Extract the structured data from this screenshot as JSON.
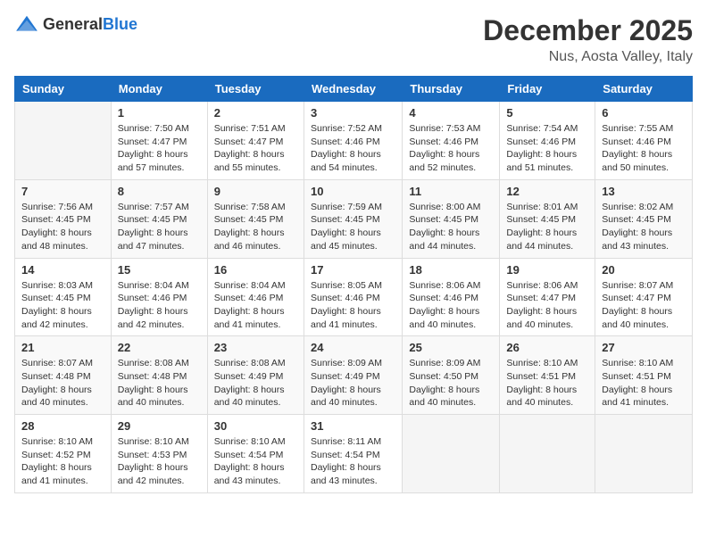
{
  "header": {
    "logo_general": "General",
    "logo_blue": "Blue",
    "month": "December 2025",
    "location": "Nus, Aosta Valley, Italy"
  },
  "weekdays": [
    "Sunday",
    "Monday",
    "Tuesday",
    "Wednesday",
    "Thursday",
    "Friday",
    "Saturday"
  ],
  "weeks": [
    [
      {
        "day": "",
        "content": ""
      },
      {
        "day": "1",
        "content": "Sunrise: 7:50 AM\nSunset: 4:47 PM\nDaylight: 8 hours\nand 57 minutes."
      },
      {
        "day": "2",
        "content": "Sunrise: 7:51 AM\nSunset: 4:47 PM\nDaylight: 8 hours\nand 55 minutes."
      },
      {
        "day": "3",
        "content": "Sunrise: 7:52 AM\nSunset: 4:46 PM\nDaylight: 8 hours\nand 54 minutes."
      },
      {
        "day": "4",
        "content": "Sunrise: 7:53 AM\nSunset: 4:46 PM\nDaylight: 8 hours\nand 52 minutes."
      },
      {
        "day": "5",
        "content": "Sunrise: 7:54 AM\nSunset: 4:46 PM\nDaylight: 8 hours\nand 51 minutes."
      },
      {
        "day": "6",
        "content": "Sunrise: 7:55 AM\nSunset: 4:46 PM\nDaylight: 8 hours\nand 50 minutes."
      }
    ],
    [
      {
        "day": "7",
        "content": "Sunrise: 7:56 AM\nSunset: 4:45 PM\nDaylight: 8 hours\nand 48 minutes."
      },
      {
        "day": "8",
        "content": "Sunrise: 7:57 AM\nSunset: 4:45 PM\nDaylight: 8 hours\nand 47 minutes."
      },
      {
        "day": "9",
        "content": "Sunrise: 7:58 AM\nSunset: 4:45 PM\nDaylight: 8 hours\nand 46 minutes."
      },
      {
        "day": "10",
        "content": "Sunrise: 7:59 AM\nSunset: 4:45 PM\nDaylight: 8 hours\nand 45 minutes."
      },
      {
        "day": "11",
        "content": "Sunrise: 8:00 AM\nSunset: 4:45 PM\nDaylight: 8 hours\nand 44 minutes."
      },
      {
        "day": "12",
        "content": "Sunrise: 8:01 AM\nSunset: 4:45 PM\nDaylight: 8 hours\nand 44 minutes."
      },
      {
        "day": "13",
        "content": "Sunrise: 8:02 AM\nSunset: 4:45 PM\nDaylight: 8 hours\nand 43 minutes."
      }
    ],
    [
      {
        "day": "14",
        "content": "Sunrise: 8:03 AM\nSunset: 4:45 PM\nDaylight: 8 hours\nand 42 minutes."
      },
      {
        "day": "15",
        "content": "Sunrise: 8:04 AM\nSunset: 4:46 PM\nDaylight: 8 hours\nand 42 minutes."
      },
      {
        "day": "16",
        "content": "Sunrise: 8:04 AM\nSunset: 4:46 PM\nDaylight: 8 hours\nand 41 minutes."
      },
      {
        "day": "17",
        "content": "Sunrise: 8:05 AM\nSunset: 4:46 PM\nDaylight: 8 hours\nand 41 minutes."
      },
      {
        "day": "18",
        "content": "Sunrise: 8:06 AM\nSunset: 4:46 PM\nDaylight: 8 hours\nand 40 minutes."
      },
      {
        "day": "19",
        "content": "Sunrise: 8:06 AM\nSunset: 4:47 PM\nDaylight: 8 hours\nand 40 minutes."
      },
      {
        "day": "20",
        "content": "Sunrise: 8:07 AM\nSunset: 4:47 PM\nDaylight: 8 hours\nand 40 minutes."
      }
    ],
    [
      {
        "day": "21",
        "content": "Sunrise: 8:07 AM\nSunset: 4:48 PM\nDaylight: 8 hours\nand 40 minutes."
      },
      {
        "day": "22",
        "content": "Sunrise: 8:08 AM\nSunset: 4:48 PM\nDaylight: 8 hours\nand 40 minutes."
      },
      {
        "day": "23",
        "content": "Sunrise: 8:08 AM\nSunset: 4:49 PM\nDaylight: 8 hours\nand 40 minutes."
      },
      {
        "day": "24",
        "content": "Sunrise: 8:09 AM\nSunset: 4:49 PM\nDaylight: 8 hours\nand 40 minutes."
      },
      {
        "day": "25",
        "content": "Sunrise: 8:09 AM\nSunset: 4:50 PM\nDaylight: 8 hours\nand 40 minutes."
      },
      {
        "day": "26",
        "content": "Sunrise: 8:10 AM\nSunset: 4:51 PM\nDaylight: 8 hours\nand 40 minutes."
      },
      {
        "day": "27",
        "content": "Sunrise: 8:10 AM\nSunset: 4:51 PM\nDaylight: 8 hours\nand 41 minutes."
      }
    ],
    [
      {
        "day": "28",
        "content": "Sunrise: 8:10 AM\nSunset: 4:52 PM\nDaylight: 8 hours\nand 41 minutes."
      },
      {
        "day": "29",
        "content": "Sunrise: 8:10 AM\nSunset: 4:53 PM\nDaylight: 8 hours\nand 42 minutes."
      },
      {
        "day": "30",
        "content": "Sunrise: 8:10 AM\nSunset: 4:54 PM\nDaylight: 8 hours\nand 43 minutes."
      },
      {
        "day": "31",
        "content": "Sunrise: 8:11 AM\nSunset: 4:54 PM\nDaylight: 8 hours\nand 43 minutes."
      },
      {
        "day": "",
        "content": ""
      },
      {
        "day": "",
        "content": ""
      },
      {
        "day": "",
        "content": ""
      }
    ]
  ]
}
